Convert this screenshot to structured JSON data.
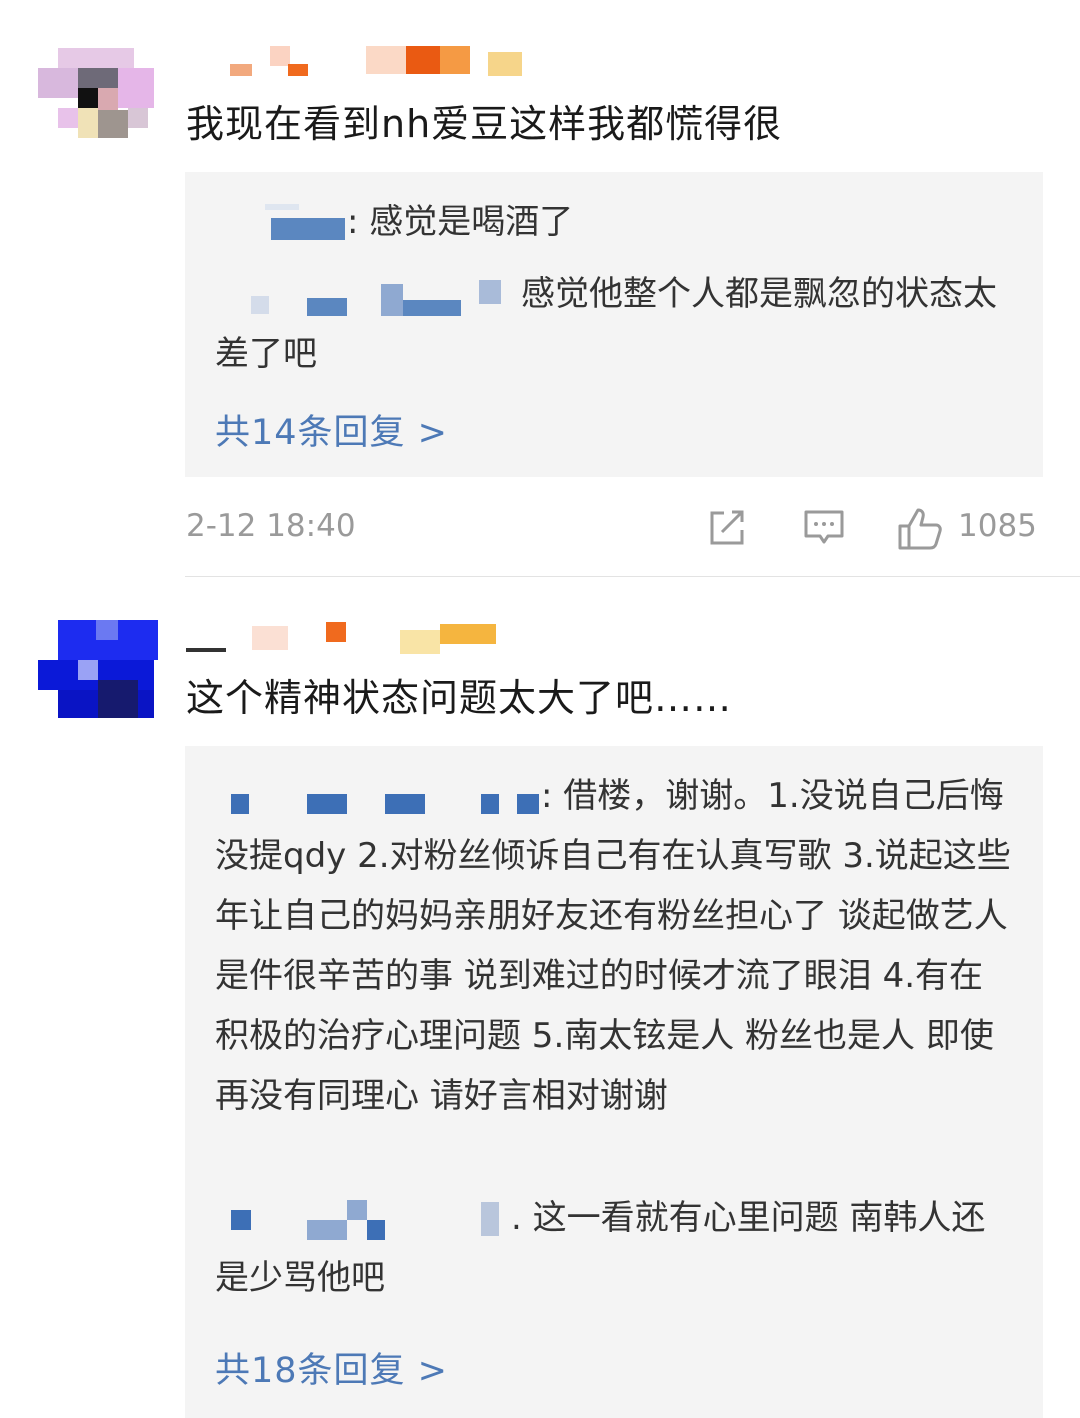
{
  "comments": [
    {
      "text": "我现在看到nh爱豆这样我都慌得很",
      "replies": [
        {
          "text": ": 感觉是喝酒了"
        },
        {
          "text": "感觉他整个人都是飘忽的状态太差了吧"
        }
      ],
      "more_replies": "共14条回复 >",
      "time": "2-12 18:40",
      "likes": "1085"
    },
    {
      "text": "这个精神状态问题太大了吧……",
      "replies": [
        {
          "text": ": 借楼，谢谢。1.没说自己后悔 没提qdy 2.对粉丝倾诉自己有在认真写歌 3.说起这些年让自己的妈妈亲朋好友还有粉丝担心了 谈起做艺人是件很辛苦的事 说到难过的时候才流了眼泪 4.有在积极的治疗心理问题 5.南太铉是人 粉丝也是人 即使再没有同理心 请好言相对谢谢"
        },
        {
          "text": ". 这一看就有心里问题 南韩人还是少骂他吧"
        }
      ],
      "more_replies": "共18条回复 >"
    }
  ],
  "icons": {
    "share": "share-icon",
    "comment": "comment-icon",
    "like": "thumbs-up-icon"
  },
  "colors": {
    "link": "#4d79b6",
    "reply_background": "#f4f4f4",
    "meta_text": "#9a9a9a"
  }
}
